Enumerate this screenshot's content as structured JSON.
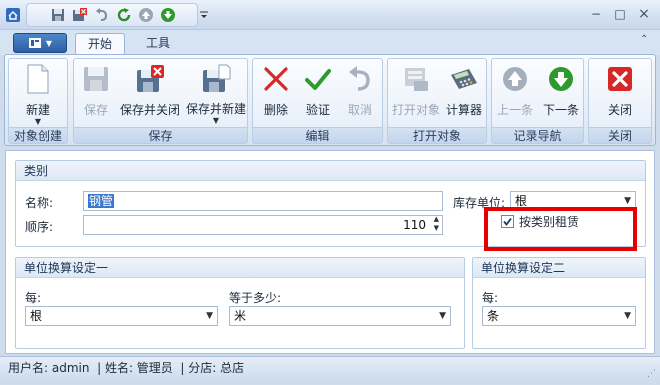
{
  "quick_access": {
    "app_icon": "home-icon",
    "buttons": [
      "save-icon",
      "save-close-icon",
      "undo-icon",
      "refresh-icon",
      "up-icon",
      "down-icon",
      "customize-icon"
    ]
  },
  "window_controls": {
    "minimize": "−",
    "maximize": "□",
    "close": "×"
  },
  "tabs": [
    {
      "label": "开始",
      "active": true
    },
    {
      "label": "工具",
      "active": false
    }
  ],
  "ribbon": {
    "groups": [
      {
        "label": "对象创建",
        "buttons": [
          {
            "label": "新建",
            "enabled": true
          }
        ]
      },
      {
        "label": "保存",
        "buttons": [
          {
            "label": "保存",
            "enabled": false
          },
          {
            "label": "保存并关闭",
            "enabled": true
          },
          {
            "label": "保存并新建",
            "enabled": true
          }
        ]
      },
      {
        "label": "编辑",
        "buttons": [
          {
            "label": "删除",
            "enabled": true
          },
          {
            "label": "验证",
            "enabled": true
          },
          {
            "label": "取消",
            "enabled": false
          }
        ]
      },
      {
        "label": "打开对象",
        "buttons": [
          {
            "label": "打开对象",
            "enabled": false
          },
          {
            "label": "计算器",
            "enabled": true
          }
        ]
      },
      {
        "label": "记录导航",
        "buttons": [
          {
            "label": "上一条",
            "enabled": false
          },
          {
            "label": "下一条",
            "enabled": true
          }
        ]
      },
      {
        "label": "关闭",
        "buttons": [
          {
            "label": "关闭",
            "enabled": true
          }
        ]
      }
    ]
  },
  "category_panel": {
    "title": "类别",
    "name_label": "名称:",
    "name_value": "钢管",
    "order_label": "顺序:",
    "order_value": "110",
    "stock_unit_label": "库存单位:",
    "stock_unit_value": "根",
    "rent_by_category_label": "按类别租赁",
    "rent_by_category_checked": true
  },
  "conversion_one": {
    "title": "单位换算设定一",
    "per_label": "每:",
    "per_value": "根",
    "equals_label": "等于多少:",
    "equals_value": "米"
  },
  "conversion_two": {
    "title": "单位换算设定二",
    "per_label": "每:",
    "per_value": "条"
  },
  "status_bar": {
    "text": "用户名: admin  | 姓名: 管理员  | 分店: 总店"
  },
  "colors": {
    "highlight_box": "#e60000",
    "accent": "#2c5fa3"
  }
}
